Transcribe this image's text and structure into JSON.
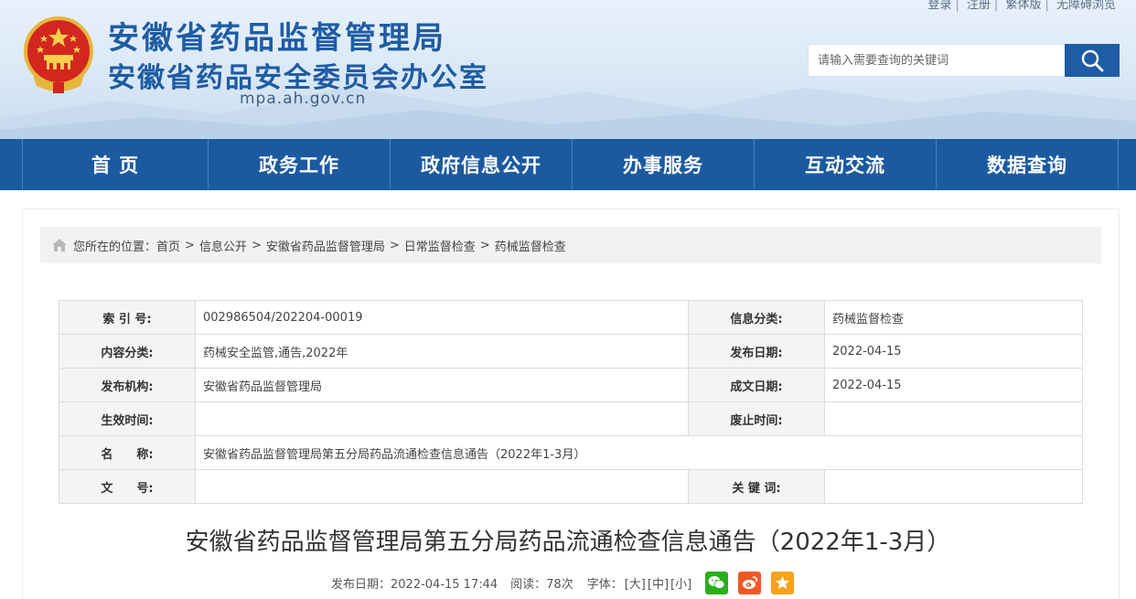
{
  "top_links": [
    "登录",
    "注册",
    "繁体版",
    "无障碍浏览"
  ],
  "site": {
    "title_line1": "安徽省药品监督管理局",
    "title_line2": "安徽省药品安全委员会办公室",
    "domain": "mpa.ah.gov.cn"
  },
  "search": {
    "placeholder": "请输入需要查询的关键词",
    "icon": "search-icon"
  },
  "nav": [
    "首 页",
    "政务工作",
    "政府信息公开",
    "办事服务",
    "互动交流",
    "数据查询"
  ],
  "breadcrumb": {
    "prefix": "您所在的位置：",
    "items": [
      "首页",
      "信息公开",
      "安徽省药品监督管理局",
      "日常监督检查",
      "药械监督检查"
    ]
  },
  "meta_table": {
    "rows": [
      {
        "l1": "索 引 号:",
        "v1": "002986504/202204-00019",
        "l2": "信息分类:",
        "v2": "药械监督检查"
      },
      {
        "l1": "内容分类:",
        "v1": "药械安全监管,通告,2022年",
        "l2": "发布日期:",
        "v2": "2022-04-15"
      },
      {
        "l1": "发布机构:",
        "v1": "安徽省药品监督管理局",
        "l2": "成文日期:",
        "v2": "2022-04-15"
      },
      {
        "l1": "生效时间:",
        "v1": "",
        "l2": "废止时间:",
        "v2": ""
      },
      {
        "l1": "名　　称:",
        "v1": "安徽省药品监督管理局第五分局药品流通检查信息通告（2022年1-3月）"
      },
      {
        "l1": "文　　号:",
        "v1": "",
        "l2": "关 键 词:",
        "v2": ""
      }
    ]
  },
  "article": {
    "title": "安徽省药品监督管理局第五分局药品流通检查信息通告（2022年1-3月）",
    "publish_label": "发布日期：2022-04-15 17:44",
    "views_label": "阅读：78次",
    "font_label": "字体：",
    "font_sizes": [
      "[大]",
      "[中]",
      "[小]"
    ]
  },
  "colors": {
    "brand": "#1c5aa0",
    "wechat": "#2aae1c",
    "weibo": "#ef5a23",
    "favorite": "#f7a21b"
  },
  "share_icons": [
    "wechat-icon",
    "weibo-icon",
    "favorite-icon"
  ]
}
